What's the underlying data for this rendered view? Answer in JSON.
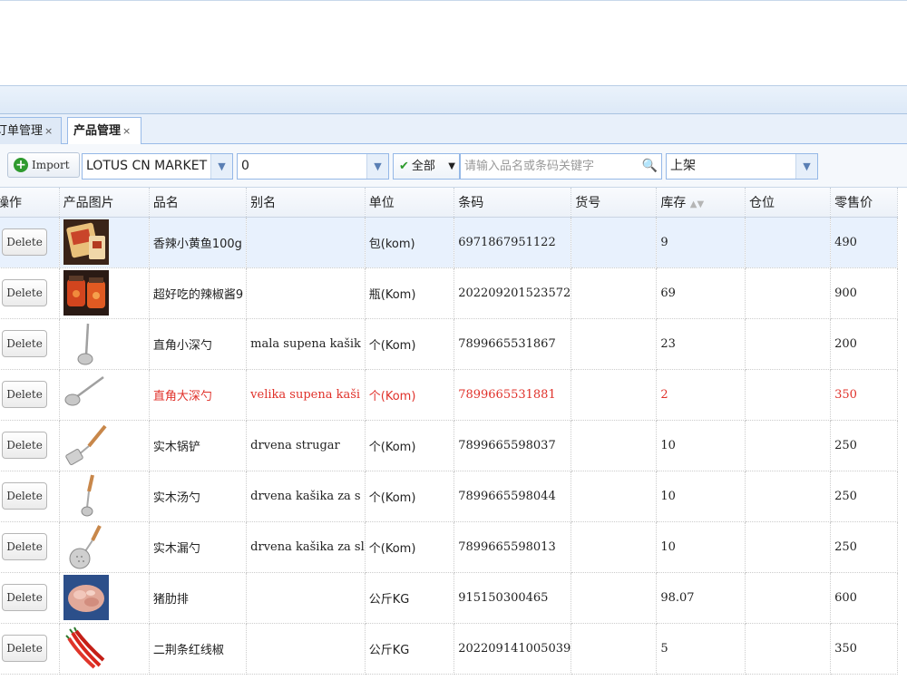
{
  "tabs": [
    {
      "label": "订单管理",
      "active": false
    },
    {
      "label": "产品管理",
      "active": true
    }
  ],
  "tab_close": "×",
  "toolbar": {
    "import_label": "Import",
    "store": "LOTUS CN MARKET",
    "category": "0",
    "status_filter": "全部",
    "search_placeholder": "请输入品名或条码关键字",
    "shelf_status": "上架"
  },
  "columns": [
    "操作",
    "产品图片",
    "品名",
    "别名",
    "单位",
    "条码",
    "货号",
    "库存",
    "仓位",
    "零售价"
  ],
  "delete_label": "Delete",
  "rows": [
    {
      "name": "香辣小黄鱼100g",
      "alias": "",
      "unit": "包(kom)",
      "barcode": "6971867951122",
      "sku": "",
      "stock": "9",
      "bin": "",
      "price": "490",
      "image": "fish-snack"
    },
    {
      "name": "超好吃的辣椒酱9",
      "alias": "",
      "unit": "瓶(Kom)",
      "barcode": "202209201523572",
      "sku": "",
      "stock": "69",
      "bin": "",
      "price": "900",
      "image": "chili-sauce-jars"
    },
    {
      "name": "直角小深勺",
      "alias": "mala supena kašik",
      "unit": "个(Kom)",
      "barcode": "7899665531867",
      "sku": "",
      "stock": "23",
      "bin": "",
      "price": "200",
      "image": "small-ladle"
    },
    {
      "name": "直角大深勺",
      "alias": "velika supena kaši",
      "unit": "个(Kom)",
      "barcode": "7899665531881",
      "sku": "",
      "stock": "2",
      "bin": "",
      "price": "350",
      "image": "large-ladle"
    },
    {
      "name": "实木锅铲",
      "alias": "drvena strugar",
      "unit": "个(Kom)",
      "barcode": "7899665598037",
      "sku": "",
      "stock": "10",
      "bin": "",
      "price": "250",
      "image": "wooden-spatula"
    },
    {
      "name": "实木汤勺",
      "alias": "drvena kašika za s",
      "unit": "个(Kom)",
      "barcode": "7899665598044",
      "sku": "",
      "stock": "10",
      "bin": "",
      "price": "250",
      "image": "wooden-soup-ladle"
    },
    {
      "name": "实木漏勺",
      "alias": "drvena kašika za sl",
      "unit": "个(Kom)",
      "barcode": "7899665598013",
      "sku": "",
      "stock": "10",
      "bin": "",
      "price": "250",
      "image": "wooden-skimmer"
    },
    {
      "name": "猪肋排",
      "alias": "",
      "unit": "公斤KG",
      "barcode": "915150300465",
      "sku": "",
      "stock": "98.07",
      "bin": "",
      "price": "600",
      "image": "pork-ribs"
    },
    {
      "name": "二荆条红线椒",
      "alias": "",
      "unit": "公斤KG",
      "barcode": "202209141005039",
      "sku": "",
      "stock": "5",
      "bin": "",
      "price": "350",
      "image": "red-chili-peppers"
    }
  ],
  "colors": {
    "accent": "#99bbe8",
    "selected_row": "#e8f1fd",
    "low_stock_text": "#e0312a"
  }
}
